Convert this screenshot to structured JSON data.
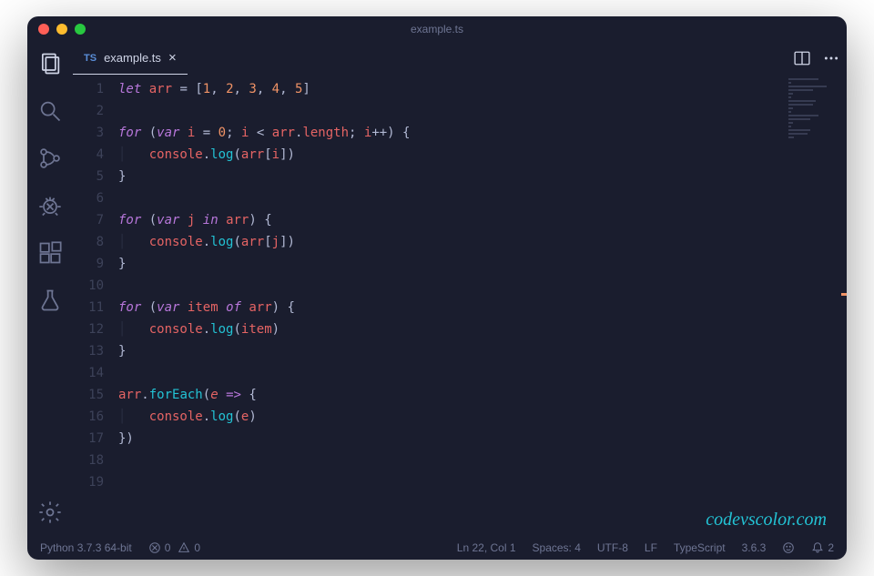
{
  "titlebar": {
    "title": "example.ts"
  },
  "tab": {
    "language_badge": "TS",
    "label": "example.ts",
    "close": "×"
  },
  "lines": [
    "1",
    "2",
    "3",
    "4",
    "5",
    "6",
    "7",
    "8",
    "9",
    "10",
    "11",
    "12",
    "13",
    "14",
    "15",
    "16",
    "17",
    "18",
    "19"
  ],
  "code_tokens": [
    [
      [
        "kw",
        "let"
      ],
      [
        "op",
        " "
      ],
      [
        "var",
        "arr"
      ],
      [
        "op",
        " "
      ],
      [
        "punct",
        "="
      ],
      [
        "op",
        " "
      ],
      [
        "punct",
        "["
      ],
      [
        "num",
        "1"
      ],
      [
        "punct",
        ", "
      ],
      [
        "num",
        "2"
      ],
      [
        "punct",
        ", "
      ],
      [
        "num",
        "3"
      ],
      [
        "punct",
        ", "
      ],
      [
        "num",
        "4"
      ],
      [
        "punct",
        ", "
      ],
      [
        "num",
        "5"
      ],
      [
        "punct",
        "]"
      ]
    ],
    [],
    [
      [
        "kw",
        "for"
      ],
      [
        "op",
        " "
      ],
      [
        "punct",
        "("
      ],
      [
        "kw",
        "var"
      ],
      [
        "op",
        " "
      ],
      [
        "var",
        "i"
      ],
      [
        "op",
        " "
      ],
      [
        "punct",
        "="
      ],
      [
        "op",
        " "
      ],
      [
        "num",
        "0"
      ],
      [
        "punct",
        "; "
      ],
      [
        "var",
        "i"
      ],
      [
        "op",
        " "
      ],
      [
        "punct",
        "<"
      ],
      [
        "op",
        " "
      ],
      [
        "var",
        "arr"
      ],
      [
        "punct",
        "."
      ],
      [
        "prop",
        "length"
      ],
      [
        "punct",
        "; "
      ],
      [
        "var",
        "i"
      ],
      [
        "punct",
        "++"
      ],
      [
        "punct",
        ") {"
      ]
    ],
    [
      [
        "indent-guide",
        "│   "
      ],
      [
        "var",
        "console"
      ],
      [
        "punct",
        "."
      ],
      [
        "method",
        "log"
      ],
      [
        "punct",
        "("
      ],
      [
        "var",
        "arr"
      ],
      [
        "punct",
        "["
      ],
      [
        "var",
        "i"
      ],
      [
        "punct",
        "])"
      ]
    ],
    [
      [
        "punct",
        "}"
      ]
    ],
    [],
    [
      [
        "kw",
        "for"
      ],
      [
        "op",
        " "
      ],
      [
        "punct",
        "("
      ],
      [
        "kw",
        "var"
      ],
      [
        "op",
        " "
      ],
      [
        "var",
        "j"
      ],
      [
        "op",
        " "
      ],
      [
        "kw",
        "in"
      ],
      [
        "op",
        " "
      ],
      [
        "var",
        "arr"
      ],
      [
        "punct",
        ") {"
      ]
    ],
    [
      [
        "indent-guide",
        "│   "
      ],
      [
        "var",
        "console"
      ],
      [
        "punct",
        "."
      ],
      [
        "method",
        "log"
      ],
      [
        "punct",
        "("
      ],
      [
        "var",
        "arr"
      ],
      [
        "punct",
        "["
      ],
      [
        "var",
        "j"
      ],
      [
        "punct",
        "])"
      ]
    ],
    [
      [
        "punct",
        "}"
      ]
    ],
    [],
    [
      [
        "kw",
        "for"
      ],
      [
        "op",
        " "
      ],
      [
        "punct",
        "("
      ],
      [
        "kw",
        "var"
      ],
      [
        "op",
        " "
      ],
      [
        "var",
        "item"
      ],
      [
        "op",
        " "
      ],
      [
        "kw",
        "of"
      ],
      [
        "op",
        " "
      ],
      [
        "var",
        "arr"
      ],
      [
        "punct",
        ") {"
      ]
    ],
    [
      [
        "indent-guide",
        "│   "
      ],
      [
        "var",
        "console"
      ],
      [
        "punct",
        "."
      ],
      [
        "method",
        "log"
      ],
      [
        "punct",
        "("
      ],
      [
        "var",
        "item"
      ],
      [
        "punct",
        ")"
      ]
    ],
    [
      [
        "punct",
        "}"
      ]
    ],
    [],
    [
      [
        "var",
        "arr"
      ],
      [
        "punct",
        "."
      ],
      [
        "method",
        "forEach"
      ],
      [
        "punct",
        "("
      ],
      [
        "param",
        "e"
      ],
      [
        "op",
        " "
      ],
      [
        "kw",
        "=>"
      ],
      [
        "op",
        " "
      ],
      [
        "punct",
        "{"
      ]
    ],
    [
      [
        "indent-guide",
        "│   "
      ],
      [
        "var",
        "console"
      ],
      [
        "punct",
        "."
      ],
      [
        "method",
        "log"
      ],
      [
        "punct",
        "("
      ],
      [
        "var",
        "e"
      ],
      [
        "punct",
        ")"
      ]
    ],
    [
      [
        "punct",
        "})"
      ]
    ],
    [],
    []
  ],
  "statusbar": {
    "python": "Python 3.7.3 64-bit",
    "errors": "0",
    "warnings": "0",
    "cursor": "Ln 22, Col 1",
    "spaces": "Spaces: 4",
    "encoding": "UTF-8",
    "eol": "LF",
    "language": "TypeScript",
    "version": "3.6.3",
    "notifications": "2"
  },
  "watermark": "codevscolor.com"
}
